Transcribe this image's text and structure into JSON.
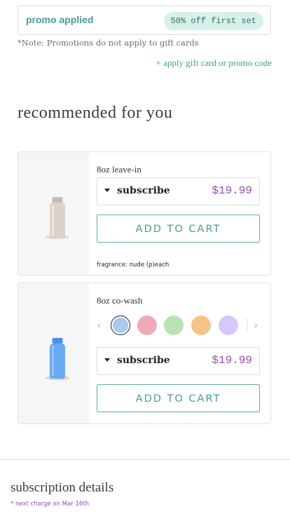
{
  "promo": {
    "label": "promo applied",
    "badge": "50% off first set"
  },
  "note": "*Note: Promotions do not apply to gift cards",
  "gift_link": "+ apply gift card or promo code",
  "recommended": {
    "title": "recommended for you",
    "products": [
      {
        "name": "8oz leave-in",
        "image": "bottle-beige",
        "plan": "subscribe",
        "price": "$19.99",
        "button": "ADD TO CART",
        "fragrance": "fragrance: nude (p)each"
      },
      {
        "name": "8oz co-wash",
        "image": "bottle-blue",
        "swatches": [
          {
            "color": "#a9c9ee",
            "selected": true
          },
          {
            "color": "#f1a9b6",
            "selected": false
          },
          {
            "color": "#b8e3b2",
            "selected": false
          },
          {
            "color": "#f8c489",
            "selected": false
          },
          {
            "color": "#d6c8f8",
            "selected": false
          }
        ],
        "plan": "subscribe",
        "price": "$19.99",
        "button": "ADD TO CART"
      }
    ]
  },
  "subscription": {
    "title": "subscription details",
    "next_charge": "* next charge on Mar 16th"
  },
  "colors": {
    "accent": "#4a9c93",
    "price": "#9a4fb4",
    "badge_bg": "#d6f0ea"
  }
}
